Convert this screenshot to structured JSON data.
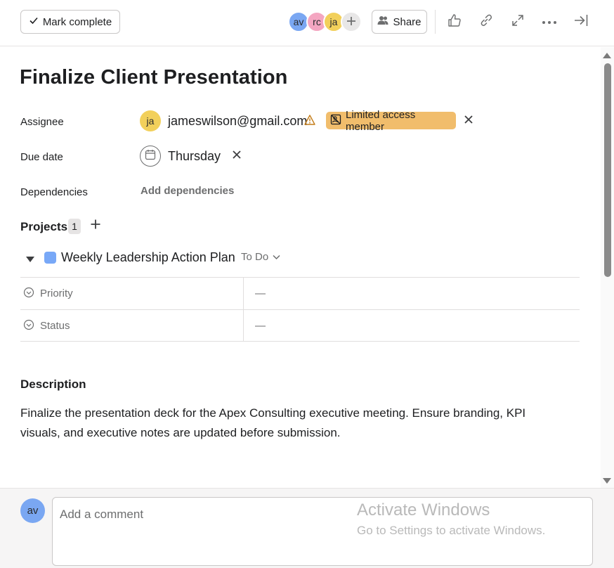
{
  "toolbar": {
    "mark_complete_label": "Mark complete",
    "collaborators": [
      {
        "initials": "av",
        "color": "#7aa7f2"
      },
      {
        "initials": "rc",
        "color": "#f4a6c1"
      },
      {
        "initials": "ja",
        "color": "#f2d05b"
      }
    ],
    "share_label": "Share"
  },
  "task": {
    "title": "Finalize Client Presentation",
    "assignee": {
      "label": "Assignee",
      "initials": "ja",
      "email": "jameswilson@gmail.com",
      "badge": "Limited access member"
    },
    "due_date": {
      "label": "Due date",
      "value": "Thursday"
    },
    "dependencies": {
      "label": "Dependencies",
      "action": "Add dependencies"
    },
    "projects": {
      "heading": "Projects",
      "count": "1",
      "items": [
        {
          "name": "Weekly Leadership Action Plan",
          "color": "#78a8f7",
          "section": "To Do",
          "fields": [
            {
              "name": "Priority",
              "value": "—"
            },
            {
              "name": "Status",
              "value": "—"
            }
          ]
        }
      ]
    },
    "description": {
      "heading": "Description",
      "text": "Finalize the presentation deck for the Apex Consulting executive meeting. Ensure branding, KPI visuals, and executive notes are updated before submission."
    }
  },
  "comment": {
    "avatar_initials": "av",
    "placeholder": "Add a comment"
  },
  "watermark": {
    "title": "Activate Windows",
    "subtitle": "Go to Settings to activate Windows."
  }
}
